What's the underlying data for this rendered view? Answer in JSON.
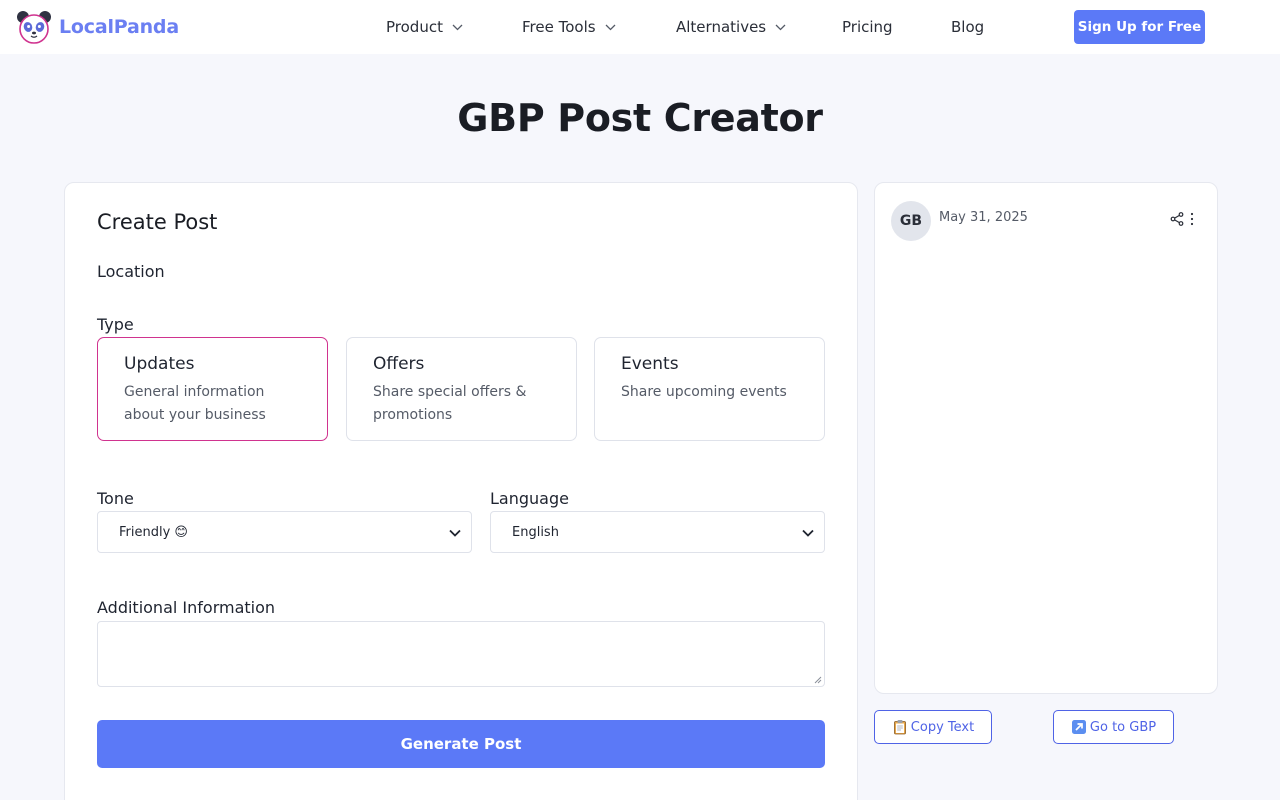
{
  "header": {
    "brand": "LocalPanda",
    "nav": {
      "product": "Product",
      "free_tools": "Free Tools",
      "alternatives": "Alternatives",
      "pricing": "Pricing",
      "blog": "Blog"
    },
    "signup_label": "Sign Up for Free"
  },
  "page": {
    "title": "GBP Post Creator"
  },
  "form": {
    "heading": "Create Post",
    "location_label": "Location",
    "type_label": "Type",
    "types": [
      {
        "title": "Updates",
        "description": "General information about your business",
        "selected": true
      },
      {
        "title": "Offers",
        "description": "Share special offers & promotions",
        "selected": false
      },
      {
        "title": "Events",
        "description": "Share upcoming events",
        "selected": false
      }
    ],
    "tone_label": "Tone",
    "tone_value": "Friendly 😊",
    "language_label": "Language",
    "language_value": "English",
    "additional_label": "Additional Information",
    "additional_value": "",
    "generate_label": "Generate Post"
  },
  "preview": {
    "avatar_initials": "GB",
    "date": "May 31, 2025",
    "copy_label": "Copy Text",
    "go_label": "Go to GBP"
  },
  "colors": {
    "accent": "#5b79f7",
    "selected_border": "#d0338f",
    "brand_text": "#6b7ff2"
  },
  "icons": {
    "logo": "panda-logo-icon",
    "chevron": "chevron-down-icon",
    "select_arrow": "select-arrow-icon",
    "share": "share-icon",
    "more": "more-vertical-icon",
    "copy": "clipboard-icon",
    "go": "external-link-icon"
  }
}
